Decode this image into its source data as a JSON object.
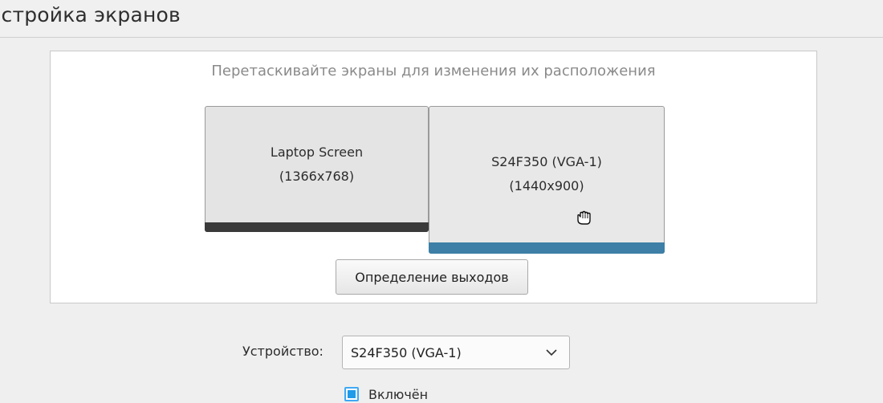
{
  "header": {
    "title": "астройка экранов"
  },
  "layout_panel": {
    "hint": "Перетаскивайте экраны для изменения их расположения",
    "screens": [
      {
        "name": "Laptop Screen",
        "resolution": "(1366x768)",
        "bar_color": "#3a3a3a"
      },
      {
        "name": "S24F350 (VGA-1)",
        "resolution": "(1440x900)",
        "bar_color": "#3d7fa6"
      }
    ],
    "cursor_icon": "hand-grab-icon",
    "identify_button": "Определение выходов"
  },
  "settings": {
    "device_label": "Устройство:",
    "device_value": "S24F350 (VGA-1)",
    "enabled_label": "Включён",
    "enabled_checked": true
  },
  "colors": {
    "accent": "#3d7fa6",
    "checkbox": "#1e9be9"
  }
}
